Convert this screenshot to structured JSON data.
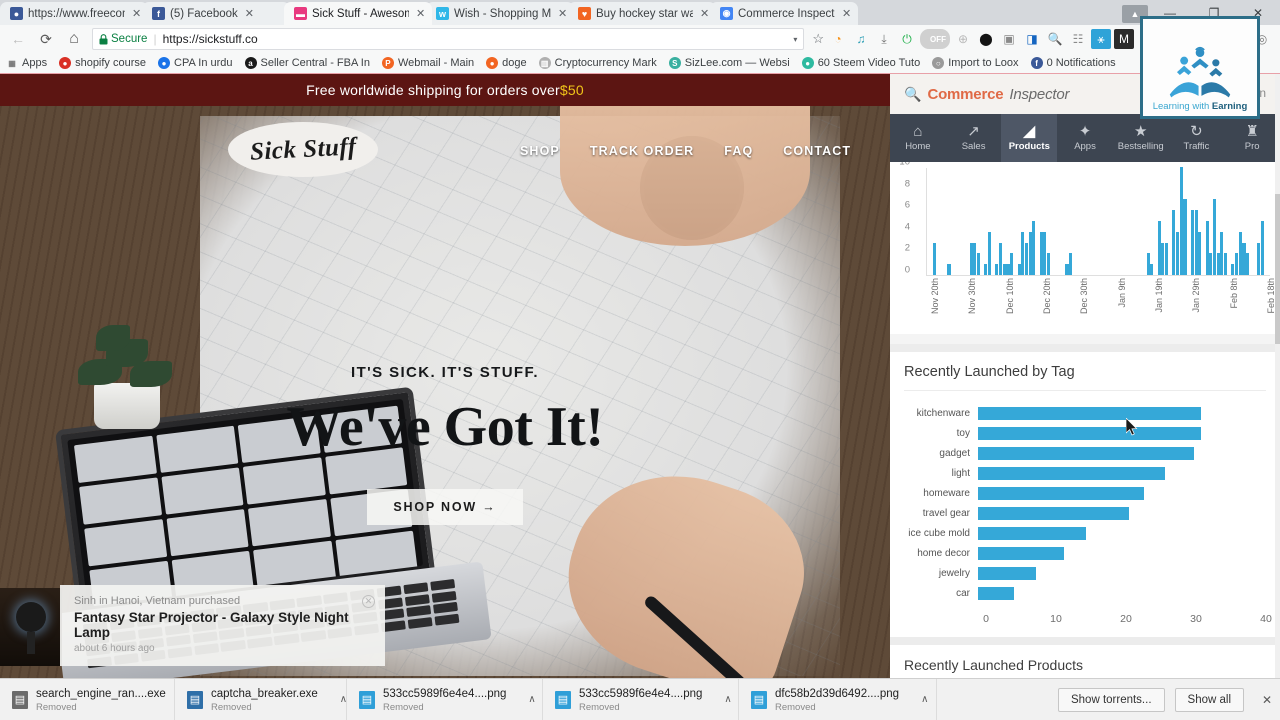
{
  "browser": {
    "tabs": [
      {
        "title": "https://www.freeconfere",
        "favicon_color": "#3b5998",
        "favicon_glyph": "●",
        "active": false
      },
      {
        "title": "(5) Facebook",
        "favicon_color": "#3b5998",
        "favicon_glyph": "f",
        "active": false
      },
      {
        "title": "Sick Stuff - Awesome Gif",
        "favicon_color": "#e8397f",
        "favicon_glyph": "▬",
        "active": true
      },
      {
        "title": "Wish - Shopping Made E",
        "favicon_color": "#2fb7e8",
        "favicon_glyph": "w",
        "active": false
      },
      {
        "title": "Buy hockey star wars de",
        "favicon_color": "#f26522",
        "favicon_glyph": "♥",
        "active": false
      },
      {
        "title": "Commerce Inspector - C",
        "favicon_color": "#4285f4",
        "favicon_glyph": "◉",
        "active": false
      }
    ],
    "window_controls": {
      "minimize": "—",
      "maximize": "❐",
      "close": "✕",
      "profile": "▲"
    },
    "nav": {
      "back": "←",
      "forward": "→",
      "reload": "⟳",
      "home": "⌂",
      "secure_label": "Secure",
      "lock_icon": "🔒",
      "url": "https://sickstuff.co",
      "dropdown_caret": "▾",
      "star_icon": "☆"
    },
    "extensions": [
      {
        "name": "pacman-extension-icon",
        "glyph": "◔",
        "color": "#f7941d",
        "bg": "transparent"
      },
      {
        "name": "headphones-extension-icon",
        "glyph": "♫",
        "color": "#2e9fb5",
        "bg": "transparent"
      },
      {
        "name": "download-hand-extension-icon",
        "glyph": "⤓",
        "color": "#777777",
        "bg": "transparent"
      },
      {
        "name": "power-extension-icon",
        "glyph": "⏻",
        "color": "#22b14c",
        "bg": "transparent"
      },
      {
        "name": "toggle-off-extension-icon",
        "glyph": "OFF",
        "color": "#ffffff",
        "bg": "#d0d0d0"
      },
      {
        "name": "globe-extension-icon",
        "glyph": "⊕",
        "color": "#b9b9b9",
        "bg": "transparent"
      },
      {
        "name": "mask-extension-icon",
        "glyph": "⬤",
        "color": "#141414",
        "bg": "transparent"
      },
      {
        "name": "tag-extension-icon",
        "glyph": "▣",
        "color": "#8a8a8a",
        "bg": "transparent"
      },
      {
        "name": "blue-square-extension-icon",
        "glyph": "◨",
        "color": "#1565c0",
        "bg": "transparent"
      },
      {
        "name": "search-extension-icon",
        "glyph": "🔍",
        "color": "#d04a4a",
        "bg": "transparent"
      },
      {
        "name": "calendar-extension-icon",
        "glyph": "☷",
        "color": "#8a8a8a",
        "bg": "transparent"
      },
      {
        "name": "person-extension-icon",
        "glyph": "⚹",
        "color": "#ffffff",
        "bg": "#2fa3d8"
      },
      {
        "name": "m-extension-icon",
        "glyph": "M",
        "color": "#ffffff",
        "bg": "#2b2b2b"
      },
      {
        "name": "cart-extension-icon",
        "glyph": "🛒",
        "color": "#e02020",
        "bg": "transparent"
      },
      {
        "name": "target-extension-icon",
        "glyph": "◎",
        "color": "#f5a623",
        "bg": "transparent"
      },
      {
        "name": "mountain-extension-icon",
        "glyph": "▲",
        "color": "#e8b7b0",
        "bg": "transparent"
      },
      {
        "name": "bars-extension-icon",
        "glyph": "▐",
        "color": "#c8d8e2",
        "bg": "transparent"
      },
      {
        "name": "bitcoin-extension-icon",
        "glyph": "Ƀ",
        "color": "#9a9a9a",
        "bg": "transparent"
      },
      {
        "name": "camera-extension-icon",
        "glyph": "◎",
        "color": "#7a7a7a",
        "bg": "transparent"
      }
    ],
    "bookmarks": [
      {
        "label": "Apps",
        "icon_color": "#888888",
        "glyph": "▦"
      },
      {
        "label": "shopify course",
        "icon_color": "#d93025",
        "glyph": "●"
      },
      {
        "label": "CPA In urdu",
        "icon_color": "#1a73e8",
        "glyph": "●"
      },
      {
        "label": "Seller Central - FBA In",
        "icon_color": "#1a1a1a",
        "glyph": "a"
      },
      {
        "label": "Webmail - Main",
        "icon_color": "#f26522",
        "glyph": "P"
      },
      {
        "label": "doge",
        "icon_color": "#f26522",
        "glyph": "●"
      },
      {
        "label": "Cryptocurrency Mark",
        "icon_color": "#b0b0b0",
        "glyph": "▥"
      },
      {
        "label": "SizLee.com — Websi",
        "icon_color": "#3ab0a0",
        "glyph": "S"
      },
      {
        "label": "60 Steem Video Tuto",
        "icon_color": "#2ebaa0",
        "glyph": "●"
      },
      {
        "label": "Import to Loox",
        "icon_color": "#9a9a9a",
        "glyph": "○"
      },
      {
        "label": "0 Notifications",
        "icon_color": "#3b5998",
        "glyph": "f"
      }
    ]
  },
  "overlay_logo": {
    "caption_first": "Learning with ",
    "caption_second": "Earning"
  },
  "site": {
    "announcement_prefix": "Free worldwide shipping for orders over ",
    "announcement_amount": "$50",
    "brand": "Sick Stuff",
    "menu": [
      "SHOP",
      "TRACK ORDER",
      "FAQ",
      "CONTACT"
    ],
    "hero_kicker": "IT'S SICK. IT'S STUFF.",
    "hero_title": "We've Got It!",
    "cta": "SHOP NOW →",
    "notification": {
      "line1": "Sinh in Hanoi, Vietnam purchased",
      "product": "Fantasy Star Projector - Galaxy Style Night Lamp",
      "time": "about 6 hours ago",
      "close_glyph": "✕"
    }
  },
  "extension_panel": {
    "logo_first": "Commerce",
    "logo_second": "Inspector",
    "search_glyph": "🔍",
    "login": "Login",
    "nav": [
      {
        "label": "Home",
        "icon": "home-icon",
        "glyph": "⌂",
        "active": false
      },
      {
        "label": "Sales",
        "icon": "chart-line-icon",
        "glyph": "↗",
        "active": false
      },
      {
        "label": "Products",
        "icon": "tag-icon",
        "glyph": "◢",
        "active": true
      },
      {
        "label": "Apps",
        "icon": "puzzle-icon",
        "glyph": "✦",
        "active": false
      },
      {
        "label": "Bestselling",
        "icon": "star-icon",
        "glyph": "★",
        "active": false
      },
      {
        "label": "Traffic",
        "icon": "refresh-icon",
        "glyph": "↻",
        "active": false
      },
      {
        "label": "Pro",
        "icon": "trophy-icon",
        "glyph": "♜",
        "active": false
      }
    ],
    "products_section_title": "Recently Launched Products"
  },
  "chart_data": [
    {
      "type": "bar",
      "name": "recently-launched-timeline",
      "title": "",
      "xlabel": "",
      "ylabel": "",
      "ylim": [
        0,
        10
      ],
      "yticks": [
        0,
        2,
        4,
        6,
        8,
        10
      ],
      "grid": false,
      "tick_labels": [
        "Nov 20th",
        "Nov 30th",
        "Dec 10th",
        "Dec 20th",
        "Dec 30th",
        "Jan 9th",
        "Jan 19th",
        "Jan 29th",
        "Feb 8th",
        "Feb 18th"
      ],
      "tick_positions": [
        1,
        11,
        21,
        31,
        41,
        51,
        61,
        71,
        81,
        91
      ],
      "values": [
        0,
        3,
        0,
        0,
        0,
        1,
        0,
        0,
        0,
        0,
        0,
        3,
        3,
        2,
        0,
        1,
        4,
        0,
        1,
        3,
        1,
        1,
        2,
        0,
        1,
        4,
        3,
        4,
        5,
        0,
        4,
        4,
        2,
        0,
        0,
        0,
        0,
        1,
        2,
        0,
        0,
        0,
        0,
        0,
        0,
        0,
        0,
        0,
        0,
        0,
        0,
        0,
        0,
        0,
        0,
        0,
        0,
        0,
        0,
        2,
        1,
        0,
        5,
        3,
        3,
        0,
        6,
        4,
        10,
        7,
        0,
        6,
        6,
        4,
        0,
        5,
        2,
        7,
        2,
        4,
        2,
        0,
        1,
        2,
        4,
        3,
        2,
        0,
        0,
        3,
        5,
        0
      ]
    },
    {
      "type": "bar",
      "orientation": "horizontal",
      "name": "recently-launched-by-tag",
      "title": "Recently Launched by Tag",
      "xlabel": "",
      "ylabel": "",
      "xlim": [
        0,
        40
      ],
      "xticks": [
        0,
        10,
        20,
        30,
        40
      ],
      "grid": false,
      "categories": [
        "kitchenware",
        "toy",
        "gadget",
        "light",
        "homeware",
        "travel gear",
        "ice cube mold",
        "home decor",
        "jewelry",
        "car"
      ],
      "values": [
        31,
        31,
        30,
        26,
        23,
        21,
        15,
        12,
        8,
        5
      ],
      "bar_color": "#35a8d8"
    }
  ],
  "downloads": {
    "items": [
      {
        "name": "search_engine_ran....exe",
        "status": "Removed",
        "icon": "exe-file-icon",
        "icon_color": "#6b6b6b",
        "glyph": "▤"
      },
      {
        "name": "captcha_breaker.exe",
        "status": "Removed",
        "icon": "exe-file-icon",
        "icon_color": "#2f6fa8",
        "glyph": "▤"
      },
      {
        "name": "533cc5989f6e4e4....png",
        "status": "Removed",
        "icon": "png-file-icon",
        "icon_color": "#2f9fd8",
        "glyph": "▤"
      },
      {
        "name": "533cc5989f6e4e4....png",
        "status": "Removed",
        "icon": "png-file-icon",
        "icon_color": "#2f9fd8",
        "glyph": "▤"
      },
      {
        "name": "dfc58b2d39d6492....png",
        "status": "Removed",
        "icon": "png-file-icon",
        "icon_color": "#2f9fd8",
        "glyph": "▤"
      }
    ],
    "chevron": "∧",
    "show_torrents": "Show torrents...",
    "show_all": "Show all",
    "close_glyph": "✕"
  }
}
